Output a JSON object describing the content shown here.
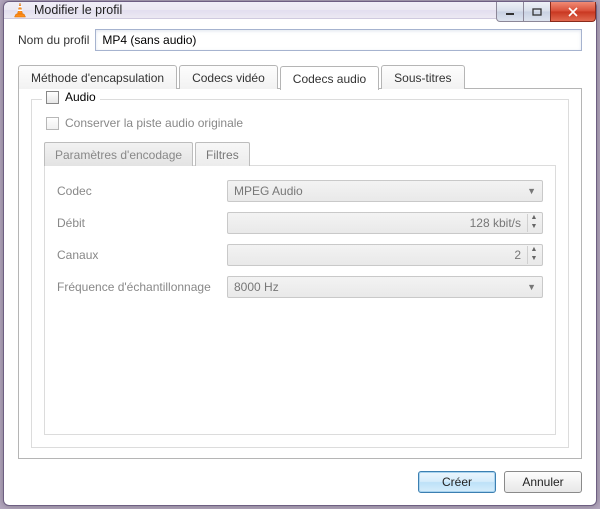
{
  "window": {
    "title": "Modifier le profil"
  },
  "profile": {
    "name_label": "Nom du profil",
    "name_value": "MP4 (sans audio)"
  },
  "tabs": {
    "encapsulation": "Méthode d'encapsulation",
    "video_codecs": "Codecs vidéo",
    "audio_codecs": "Codecs audio",
    "subtitles": "Sous-titres",
    "active": "audio_codecs"
  },
  "audio_group": {
    "legend": "Audio",
    "keep_original": "Conserver la piste audio originale"
  },
  "inner_tabs": {
    "encoding_params": "Paramètres d'encodage",
    "filters": "Filtres",
    "active": "encoding_params"
  },
  "fields": {
    "codec": {
      "label": "Codec",
      "value": "MPEG Audio"
    },
    "bitrate": {
      "label": "Débit",
      "value": "128 kbit/s"
    },
    "channels": {
      "label": "Canaux",
      "value": "2"
    },
    "samplerate": {
      "label": "Fréquence d'échantillonnage",
      "value": "8000 Hz"
    }
  },
  "buttons": {
    "create": "Créer",
    "cancel": "Annuler"
  }
}
